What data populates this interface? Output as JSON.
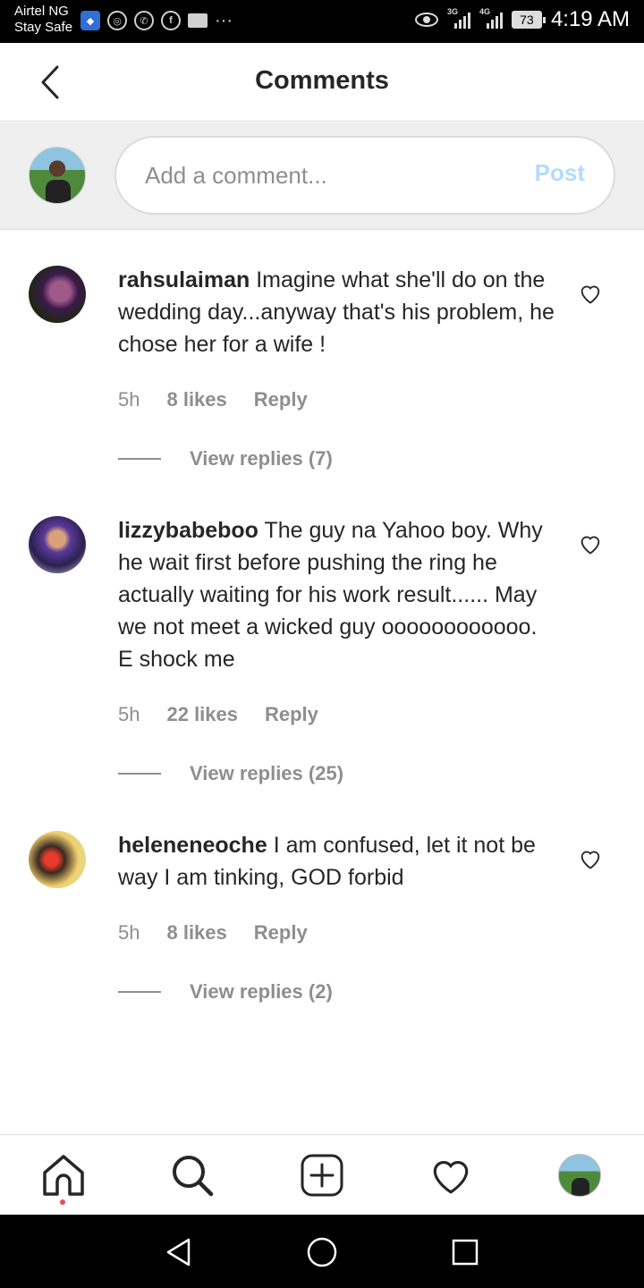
{
  "status_bar": {
    "carrier_line1": "Airtel NG",
    "carrier_line2": "Stay Safe",
    "network1": "3G",
    "network2": "4G",
    "battery": "73",
    "time": "4:19 AM"
  },
  "header": {
    "title": "Comments"
  },
  "composer": {
    "placeholder": "Add a comment...",
    "post_label": "Post"
  },
  "comments": [
    {
      "username": "rahsulaiman",
      "text": "Imagine what she'll do on the wedding day...anyway that's his problem, he chose her for a wife !",
      "time": "5h",
      "likes": "8 likes",
      "reply": "Reply",
      "view_replies": "View replies (7)"
    },
    {
      "username": "lizzybabeboo",
      "text": "The guy na Yahoo boy. Why he wait first before pushing the ring he actually waiting for his work result...... May we not meet a wicked guy oooooooooooo. E shock me",
      "time": "5h",
      "likes": "22 likes",
      "reply": "Reply",
      "view_replies": "View replies (25)"
    },
    {
      "username": "heleneneoche",
      "text": "I am confused, let it not be way I am tinking, GOD forbid",
      "time": "5h",
      "likes": "8 likes",
      "reply": "Reply",
      "view_replies": "View replies (2)"
    }
  ],
  "colors": {
    "post_disabled": "#b3dbff",
    "secondary_text": "#8e8e8e",
    "activity_dot": "#ed4956"
  }
}
